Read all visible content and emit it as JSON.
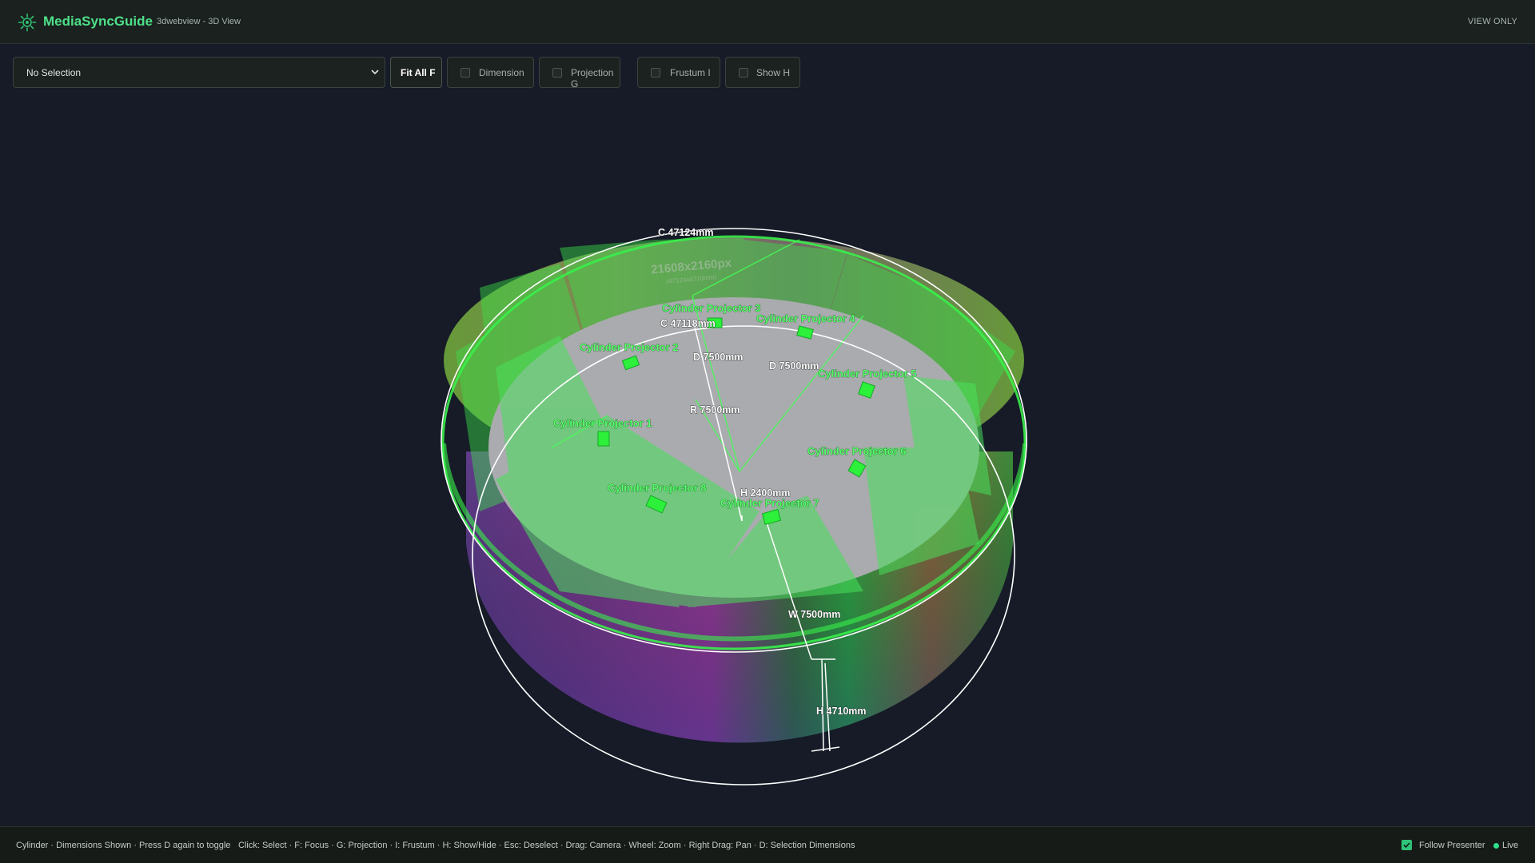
{
  "header": {
    "brand": "MediaSyncGuide",
    "subtitle": "3dwebview - 3D View",
    "view_mode": "VIEW ONLY"
  },
  "toolbar": {
    "selection": {
      "value": "No Selection",
      "options": [
        "No Selection"
      ]
    },
    "fit_all_label": "Fit All F",
    "toggles": [
      {
        "label": "Dimension",
        "checked": false
      },
      {
        "label": "Projection G",
        "checked": false
      },
      {
        "label": "Frustum I",
        "checked": false
      },
      {
        "label": "Show H",
        "checked": false
      }
    ]
  },
  "scene": {
    "dimensions": {
      "outer_circumference": "C 47124mm",
      "inner_circumference": "C 47118mm",
      "diameter_a": "D 7500mm",
      "diameter_b": "D 7500mm",
      "radius": "R 7500mm",
      "height_inner": "H 2400mm",
      "width": "W 7500mm",
      "height_outer": "H 4710mm"
    },
    "screen_resolution": "21608x2160px",
    "screen_size": "(47124x4710mm)",
    "projectors": [
      "Cylinder Projector 1",
      "Cylinder Projector 2",
      "Cylinder Projector 3",
      "Cylinder Projector 4",
      "Cylinder Projector 5",
      "Cylinder Projector 6",
      "Cylinder Projector 7",
      "Cylinder Projector 8"
    ],
    "colors": {
      "accent": "#4ee08a",
      "projector": "#2cf03a",
      "dimension_line": "#ffffff",
      "floor": "#a9abae"
    }
  },
  "footer": {
    "status": "Cylinder · Dimensions Shown · Press D again to toggle",
    "help": "Click: Select · F: Focus · G: Projection · I: Frustum · H: Show/Hide · Esc: Deselect · Drag: Camera · Wheel: Zoom · Right Drag: Pan · D: Selection Dimensions",
    "follow_presenter": {
      "label": "Follow Presenter",
      "checked": true
    },
    "live": "Live"
  }
}
